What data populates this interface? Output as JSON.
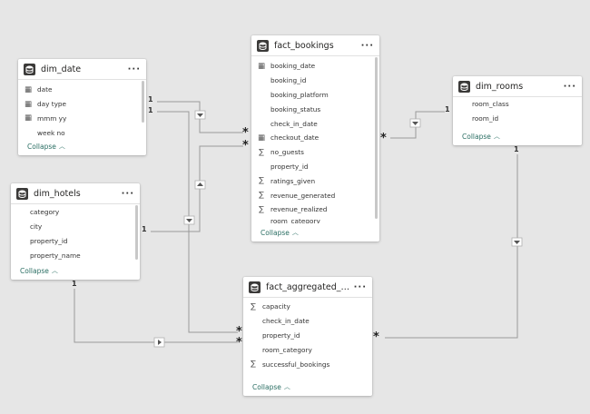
{
  "tables": [
    {
      "key": "dim_date",
      "title": "dim_date",
      "collapse_label": "Collapse",
      "fields": [
        {
          "label": "date",
          "icon": "calendar-icon"
        },
        {
          "label": "day type",
          "icon": "calendar-icon"
        },
        {
          "label": "mmm yy",
          "icon": "calendar-icon"
        },
        {
          "label": "week no",
          "icon": ""
        }
      ]
    },
    {
      "key": "fact_bookings",
      "title": "fact_bookings",
      "collapse_label": "Collapse",
      "fields": [
        {
          "label": "booking_date",
          "icon": "calendar-icon"
        },
        {
          "label": "booking_id",
          "icon": ""
        },
        {
          "label": "booking_platform",
          "icon": ""
        },
        {
          "label": "booking_status",
          "icon": ""
        },
        {
          "label": "check_in_date",
          "icon": ""
        },
        {
          "label": "checkout_date",
          "icon": "calendar-icon"
        },
        {
          "label": "no_guests",
          "icon": "sigma-icon"
        },
        {
          "label": "property_id",
          "icon": ""
        },
        {
          "label": "ratings_given",
          "icon": "sigma-icon"
        },
        {
          "label": "revenue_generated",
          "icon": "sigma-icon"
        },
        {
          "label": "revenue_realized",
          "icon": "sigma-icon"
        },
        {
          "label": "room_category",
          "icon": ""
        }
      ]
    },
    {
      "key": "dim_rooms",
      "title": "dim_rooms",
      "collapse_label": "Collapse",
      "fields": [
        {
          "label": "room_class",
          "icon": ""
        },
        {
          "label": "room_id",
          "icon": ""
        }
      ]
    },
    {
      "key": "dim_hotels",
      "title": "dim_hotels",
      "collapse_label": "Collapse",
      "fields": [
        {
          "label": "category",
          "icon": ""
        },
        {
          "label": "city",
          "icon": ""
        },
        {
          "label": "property_id",
          "icon": ""
        },
        {
          "label": "property_name",
          "icon": ""
        }
      ]
    },
    {
      "key": "fact_aggregated_bookings",
      "title": "fact_aggregated_booki...",
      "collapse_label": "Collapse",
      "fields": [
        {
          "label": "capacity",
          "icon": "sigma-icon"
        },
        {
          "label": "check_in_date",
          "icon": ""
        },
        {
          "label": "property_id",
          "icon": ""
        },
        {
          "label": "room_category",
          "icon": ""
        },
        {
          "label": "successful_bookings",
          "icon": "sigma-icon"
        }
      ]
    }
  ],
  "cardinality": {
    "one": "1",
    "many": "*"
  },
  "colors": {
    "canvas": "#e6e6e6",
    "line": "#9a9a9a",
    "accent": "#2a6e63"
  }
}
